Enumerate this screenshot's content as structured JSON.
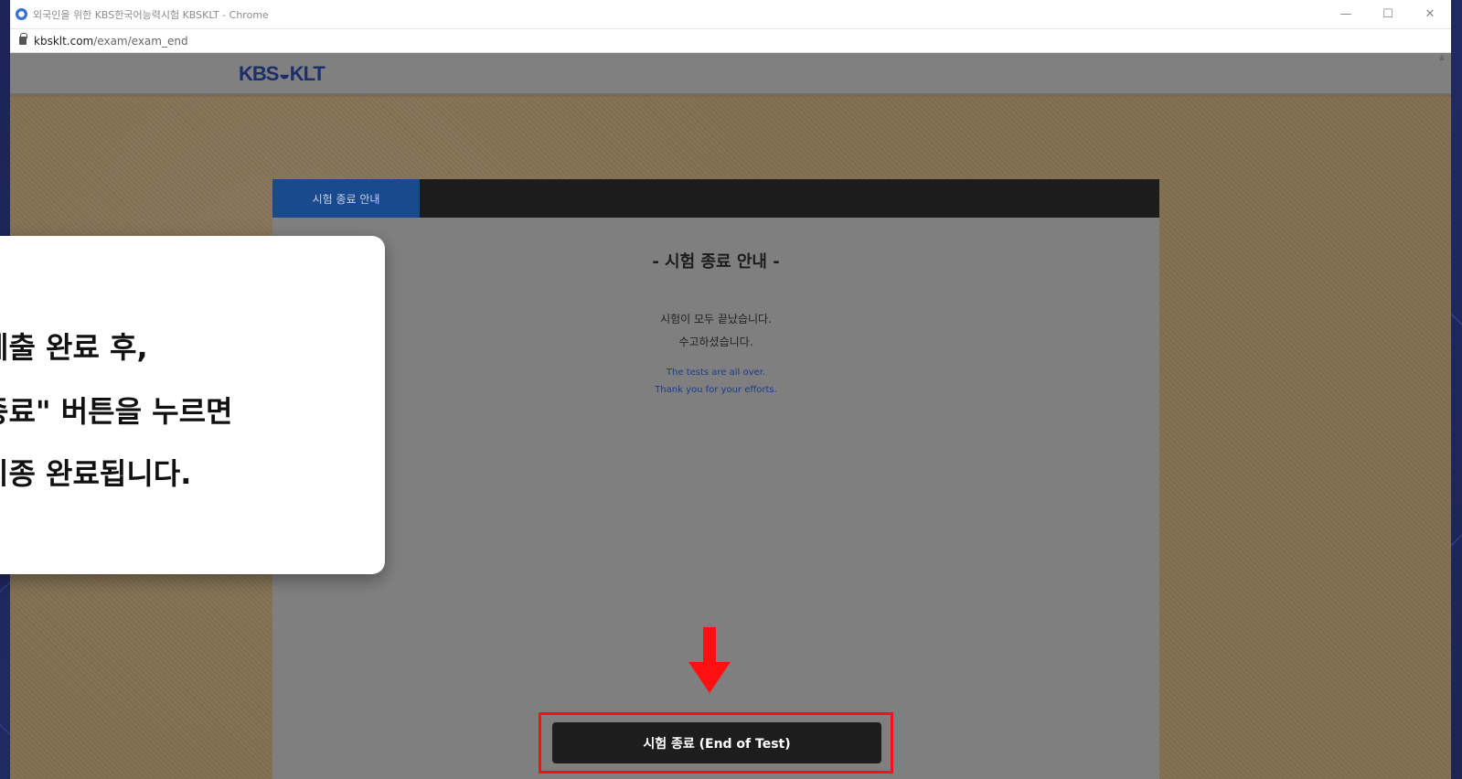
{
  "window": {
    "title": "외국인을 위한 KBS한국어능력시험 KBSKLT - Chrome",
    "controls": {
      "minimize": "—",
      "maximize": "☐",
      "close": "✕"
    }
  },
  "address_bar": {
    "host": "kbsklt.com",
    "path": "/exam/exam_end"
  },
  "site": {
    "logo": "KBS◒KLT"
  },
  "panel": {
    "tab_label": "시험 종료 안내",
    "heading": "- 시험 종료 안내 -",
    "message_ko_1": "시험이 모두 끝났습니다.",
    "message_ko_2": "수고하셨습니다.",
    "message_en_1": "The tests are all over.",
    "message_en_2": "Thank you for your efforts.",
    "end_button_label": "시험 종료 (End of Test)"
  },
  "callout": {
    "line1": "체출 완료 후,",
    "line2": "종료\" 버튼을 누르면",
    "line3": "시종 완료됩니다."
  },
  "colors": {
    "highlight": "#ff1010",
    "tab_blue": "#1a4a8e",
    "button_dark": "#1d1d1d"
  }
}
